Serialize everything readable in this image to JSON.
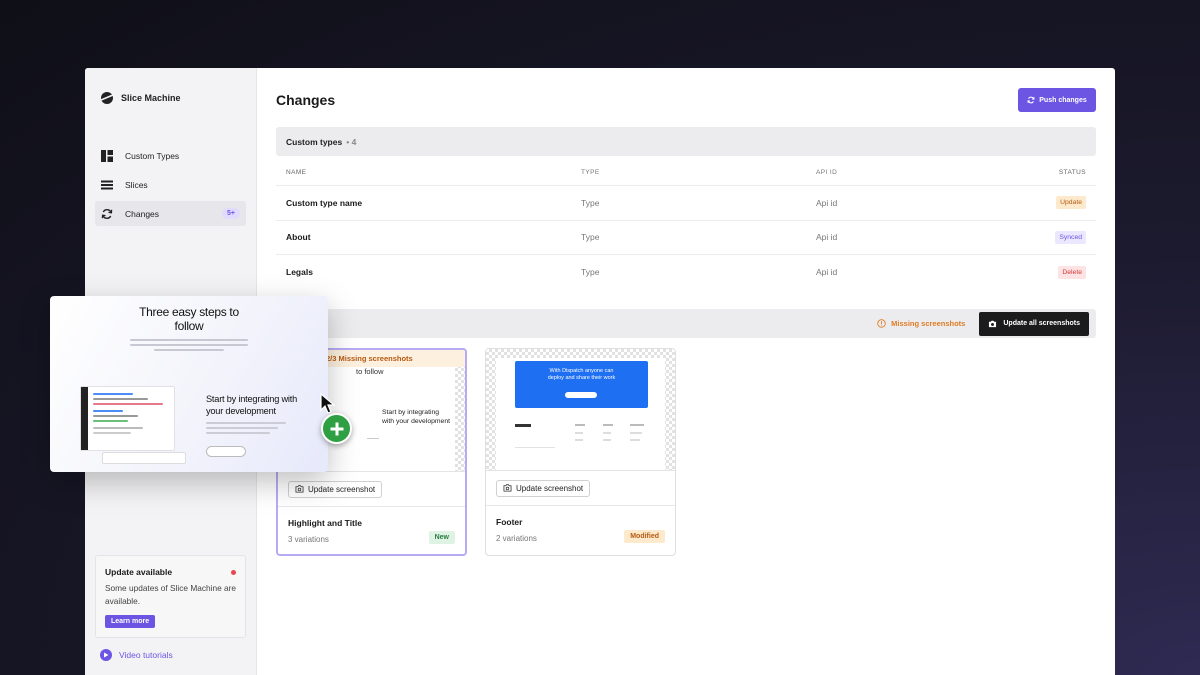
{
  "sidebar": {
    "app_name": "Slice Machine",
    "items": [
      {
        "label": "Custom Types",
        "icon": "layout-icon"
      },
      {
        "label": "Slices",
        "icon": "stack-icon"
      },
      {
        "label": "Changes",
        "icon": "sync-icon",
        "badge": "5+",
        "active": true
      }
    ],
    "update_card": {
      "title": "Update available",
      "text": "Some updates of Slice Machine are available.",
      "button": "Learn more"
    },
    "video_link": "Video tutorials"
  },
  "main": {
    "title": "Changes",
    "push_button": "Push changes",
    "custom_types_section": {
      "title": "Custom types",
      "separator": "•",
      "count": "4"
    },
    "table": {
      "headers": {
        "name": "NAME",
        "type": "TYPE",
        "api": "API ID",
        "status": "STATUS"
      },
      "rows": [
        {
          "name": "Custom type name",
          "type": "Type",
          "api": "Api id",
          "status": "Update"
        },
        {
          "name": "About",
          "type": "Type",
          "api": "Api id",
          "status": "Synced"
        },
        {
          "name": "Legals",
          "type": "Type",
          "api": "Api id",
          "status": "Delete"
        }
      ]
    },
    "slices_section": {
      "missing_link": "Missing screenshots",
      "update_all_button": "Update all screenshots"
    },
    "slices": [
      {
        "banner": "2/3 Missing screenshots",
        "thumb_text": "to follow",
        "thumb_h2": "Start by integrating with your development",
        "button": "Update screenshot",
        "name": "Highlight and Title",
        "variations": "3 variations",
        "badge": "New"
      },
      {
        "thumb_headline": "With Dispatch anyone can deploy and share their work",
        "button": "Update screenshot",
        "name": "Footer",
        "variations": "2 variations",
        "badge": "Modified"
      }
    ]
  },
  "drag_preview": {
    "title": "Three easy steps to follow",
    "heading": "Start by integrating with your development"
  },
  "colors": {
    "accent": "#6d55e3",
    "update_bg": "#fde9cc",
    "update_fg": "#b55a12",
    "synced_bg": "#ebe7ff",
    "synced_fg": "#6d55e3",
    "delete_bg": "#fde3e3",
    "delete_fg": "#d13b3b",
    "new_bg": "#dff3e4",
    "new_fg": "#2b7a44",
    "modified_bg": "#fde9cc",
    "modified_fg": "#b55a12"
  }
}
